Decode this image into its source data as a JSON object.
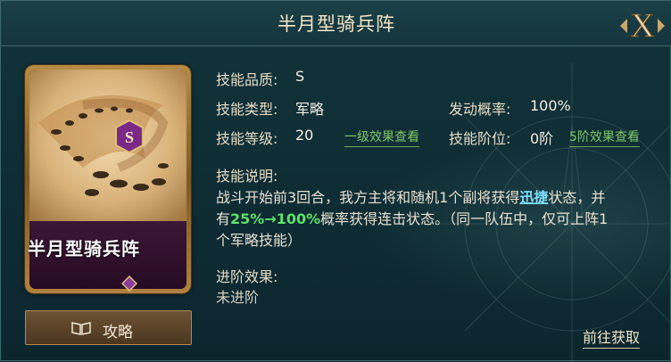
{
  "dialog": {
    "title": "半月型骑兵阵",
    "close_icon_letter": "X"
  },
  "card": {
    "name": "半月型骑兵阵",
    "grade": "S",
    "colors": {
      "frame": "#b68b45",
      "nameplate": "#3b1636",
      "badge": "#7a2a86"
    }
  },
  "guide_button": {
    "icon": "book-icon",
    "label": "攻略"
  },
  "info": {
    "quality_label": "技能品质:",
    "quality_value": "S",
    "type_label": "技能类型:",
    "type_value": "军略",
    "trigger_label": "发动概率:",
    "trigger_value": "100%",
    "level_label": "技能等级:",
    "level_value": "20",
    "level_link": "一级效果查看",
    "stage_label": "技能阶位:",
    "stage_value": "0阶",
    "stage_link": "5阶效果查看"
  },
  "description": {
    "label": "技能说明:",
    "part1": "战斗开始前3回合，我方主将和随机1个副将获得",
    "keyword": "迅捷",
    "part2": "状态，并有",
    "chance_range": "25%→100%",
    "part3": "概率获得连击状态。（同一队伍中，仅可上阵1个军略技能）"
  },
  "advance": {
    "label": "进阶效果:",
    "value": "未进阶"
  },
  "acquire_link": "前往获取"
}
